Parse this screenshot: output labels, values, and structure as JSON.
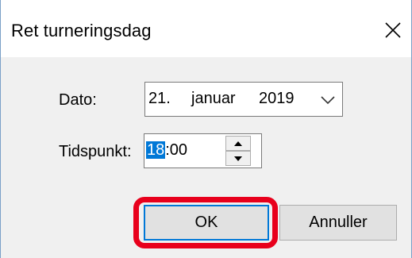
{
  "window": {
    "title": "Ret turneringsdag",
    "close_icon": "close-icon"
  },
  "form": {
    "date_label": "Dato:",
    "date_value": {
      "day": "21.",
      "month": "januar",
      "year": "2019"
    },
    "time_label": "Tidspunkt:",
    "time_value": {
      "hour": "18",
      "rest": ":00"
    }
  },
  "buttons": {
    "ok_label": "OK",
    "cancel_label": "Annuller"
  },
  "colors": {
    "highlight": "#e8001c",
    "selection": "#0078d7",
    "dialog_bg": "#f0f0f0"
  }
}
